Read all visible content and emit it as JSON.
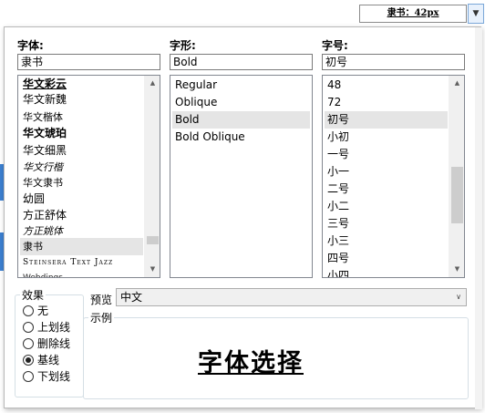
{
  "background_app": {
    "font_chip": "隶书：42px",
    "dropdown_icon": "chevron-down-icon"
  },
  "dialog": {
    "font_label": "字体:",
    "style_label": "字形:",
    "size_label": "字号:",
    "font_value": "隶书",
    "style_value": "Bold",
    "size_value": "初号",
    "font_list": [
      "华文彩云",
      "华文新魏",
      "华文楷体",
      "华文琥珀",
      "华文细黑",
      "华文行楷",
      "华文隶书",
      "幼圆",
      "方正舒体",
      "方正姚体",
      "隶书",
      "Steinsera Text Jazz",
      "Webdings"
    ],
    "font_list_selected": "隶书",
    "style_list": [
      "Regular",
      "Oblique",
      "Bold",
      "Bold Oblique"
    ],
    "style_list_selected": "Bold",
    "size_list": [
      "48",
      "72",
      "初号",
      "小初",
      "一号",
      "小一",
      "二号",
      "小二",
      "三号",
      "小三",
      "四号",
      "小四"
    ],
    "size_list_selected": "初号",
    "effects": {
      "title": "效果",
      "options": [
        "无",
        "上划线",
        "删除线",
        "基线",
        "下划线"
      ],
      "selected": "基线"
    },
    "preview": {
      "label": "预览",
      "select_value": "中文",
      "sample_title": "示例",
      "sample_text": "字体选择"
    }
  }
}
